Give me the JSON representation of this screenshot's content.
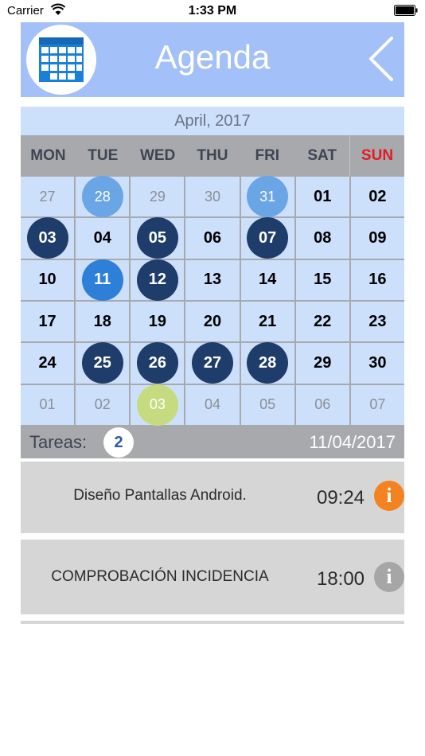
{
  "status_bar": {
    "carrier": "Carrier",
    "time": "1:33 PM"
  },
  "header": {
    "title": "Agenda",
    "logo_icon": "calendar-icon",
    "back_icon": "chevron-left-icon"
  },
  "calendar": {
    "month_label": "April, 2017",
    "weekdays": [
      "MON",
      "TUE",
      "WED",
      "THU",
      "FRI",
      "SAT",
      "SUN"
    ],
    "weekend_color": "#e01b22",
    "days": [
      {
        "label": "27",
        "muted": true,
        "mark": "none"
      },
      {
        "label": "28",
        "muted": true,
        "mark": "light"
      },
      {
        "label": "29",
        "muted": true,
        "mark": "none"
      },
      {
        "label": "30",
        "muted": true,
        "mark": "none"
      },
      {
        "label": "31",
        "muted": true,
        "mark": "light"
      },
      {
        "label": "01",
        "muted": false,
        "mark": "none"
      },
      {
        "label": "02",
        "muted": false,
        "mark": "none"
      },
      {
        "label": "03",
        "muted": false,
        "mark": "task"
      },
      {
        "label": "04",
        "muted": false,
        "mark": "none"
      },
      {
        "label": "05",
        "muted": false,
        "mark": "task"
      },
      {
        "label": "06",
        "muted": false,
        "mark": "none"
      },
      {
        "label": "07",
        "muted": false,
        "mark": "task"
      },
      {
        "label": "08",
        "muted": false,
        "mark": "none"
      },
      {
        "label": "09",
        "muted": false,
        "mark": "none"
      },
      {
        "label": "10",
        "muted": false,
        "mark": "none"
      },
      {
        "label": "11",
        "muted": false,
        "mark": "selected"
      },
      {
        "label": "12",
        "muted": false,
        "mark": "task"
      },
      {
        "label": "13",
        "muted": false,
        "mark": "none"
      },
      {
        "label": "14",
        "muted": false,
        "mark": "none"
      },
      {
        "label": "15",
        "muted": false,
        "mark": "none"
      },
      {
        "label": "16",
        "muted": false,
        "mark": "none"
      },
      {
        "label": "17",
        "muted": false,
        "mark": "none"
      },
      {
        "label": "18",
        "muted": false,
        "mark": "none"
      },
      {
        "label": "19",
        "muted": false,
        "mark": "none"
      },
      {
        "label": "20",
        "muted": false,
        "mark": "none"
      },
      {
        "label": "21",
        "muted": false,
        "mark": "none"
      },
      {
        "label": "22",
        "muted": false,
        "mark": "none"
      },
      {
        "label": "23",
        "muted": false,
        "mark": "none"
      },
      {
        "label": "24",
        "muted": false,
        "mark": "none"
      },
      {
        "label": "25",
        "muted": false,
        "mark": "task"
      },
      {
        "label": "26",
        "muted": false,
        "mark": "task"
      },
      {
        "label": "27",
        "muted": false,
        "mark": "task"
      },
      {
        "label": "28",
        "muted": false,
        "mark": "task"
      },
      {
        "label": "29",
        "muted": false,
        "mark": "none"
      },
      {
        "label": "30",
        "muted": false,
        "mark": "none"
      },
      {
        "label": "01",
        "muted": true,
        "mark": "none"
      },
      {
        "label": "02",
        "muted": true,
        "mark": "none"
      },
      {
        "label": "03",
        "muted": true,
        "mark": "today"
      },
      {
        "label": "04",
        "muted": true,
        "mark": "none"
      },
      {
        "label": "05",
        "muted": true,
        "mark": "none"
      },
      {
        "label": "06",
        "muted": true,
        "mark": "none"
      },
      {
        "label": "07",
        "muted": true,
        "mark": "none"
      }
    ]
  },
  "summary": {
    "label": "Tareas:",
    "count": "2",
    "date": "11/04/2017"
  },
  "tasks": [
    {
      "title": "Diseño Pantallas Android.",
      "time": "09:24",
      "info_icon": "info-icon",
      "info_glyph": "i",
      "info_color": "#f58220"
    },
    {
      "title": "COMPROBACIÓN INCIDENCIA",
      "time": "18:00",
      "info_icon": "info-icon",
      "info_glyph": "i",
      "info_color": "#a6a6a6"
    }
  ],
  "colors": {
    "header_bg": "#a4c0f8",
    "cell_bg": "#cde0fb",
    "task_circle": "#1f3d6b",
    "selected_circle": "#2e7fd8",
    "light_circle": "#6aa5e6",
    "today_circle": "#c6db7f"
  }
}
